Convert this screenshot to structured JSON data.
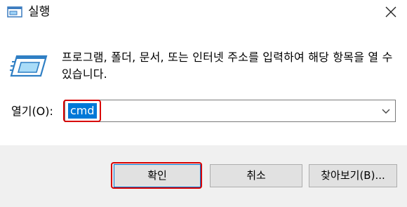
{
  "window": {
    "title": "실행",
    "close_icon": "close-icon"
  },
  "dialog": {
    "icon": "run-dialog-icon",
    "description": "프로그램, 폴더, 문서, 또는 인터넷 주소를 입력하여 해당 항목을 열 수 있습니다."
  },
  "open_field": {
    "label": "열기(O):",
    "value": "cmd",
    "selected": true,
    "highlighted": true
  },
  "buttons": {
    "ok": "확인",
    "cancel": "취소",
    "browse": "찾아보기(B)..."
  },
  "colors": {
    "selection": "#0078d7",
    "highlight_annotation": "#d80000",
    "footer_bg": "#f0f0f0",
    "button_bg": "#e1e1e1"
  }
}
